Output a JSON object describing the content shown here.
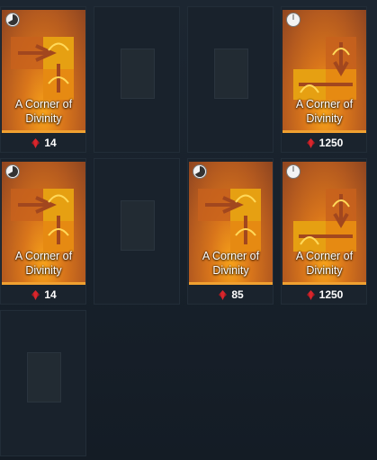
{
  "shop": {
    "item_name": "A Corner of Divinity",
    "slots": [
      {
        "filled": true,
        "name_line1": "A Corner of",
        "name_line2": "Divinity",
        "price": "14",
        "layout": "left-arrow",
        "timer": "partial"
      },
      {
        "filled": false
      },
      {
        "filled": false
      },
      {
        "filled": true,
        "name_line1": "A Corner of",
        "name_line2": "Divinity",
        "price": "1250",
        "layout": "right-arrow",
        "timer": "empty"
      },
      {
        "filled": true,
        "name_line1": "A Corner of",
        "name_line2": "Divinity",
        "price": "14",
        "layout": "left-arrow",
        "timer": "partial"
      },
      {
        "filled": false
      },
      {
        "filled": true,
        "name_line1": "A Corner of",
        "name_line2": "Divinity",
        "price": "85",
        "layout": "left-arrow",
        "timer": "partial"
      },
      {
        "filled": true,
        "name_line1": "A Corner of",
        "name_line2": "Divinity",
        "price": "1250",
        "layout": "right-arrow",
        "timer": "empty"
      },
      {
        "filled": false
      }
    ],
    "currency_icon": "red-crystal-icon",
    "accent_color": "#f0a030"
  }
}
